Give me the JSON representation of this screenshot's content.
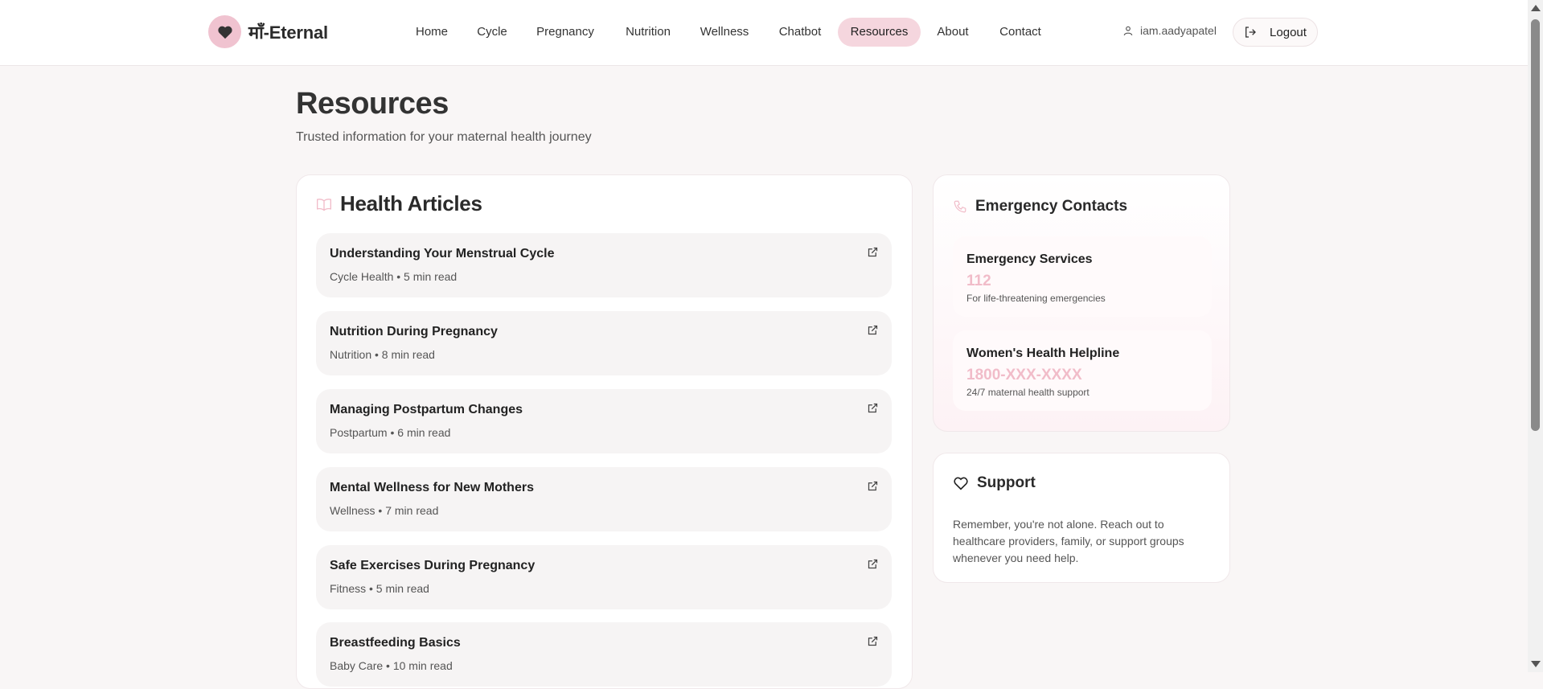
{
  "brand": {
    "name": "माँ-Eternal",
    "icon": "heart-icon",
    "badge_color": "#f0c3d0"
  },
  "nav": {
    "items": [
      {
        "label": "Home",
        "active": false
      },
      {
        "label": "Cycle",
        "active": false
      },
      {
        "label": "Pregnancy",
        "active": false
      },
      {
        "label": "Nutrition",
        "active": false
      },
      {
        "label": "Wellness",
        "active": false
      },
      {
        "label": "Chatbot",
        "active": false
      },
      {
        "label": "Resources",
        "active": true
      },
      {
        "label": "About",
        "active": false
      },
      {
        "label": "Contact",
        "active": false
      }
    ],
    "active_color": "#f5d6de"
  },
  "user": {
    "username": "iam.aadyapatel",
    "logout_label": "Logout"
  },
  "page": {
    "title": "Resources",
    "subtitle": "Trusted information for your maternal health journey"
  },
  "articles": {
    "title": "Health Articles",
    "icon": "book-open-icon",
    "items": [
      {
        "title": "Understanding Your Menstrual Cycle",
        "meta": "Cycle Health • 5 min read"
      },
      {
        "title": "Nutrition During Pregnancy",
        "meta": "Nutrition • 8 min read"
      },
      {
        "title": "Managing Postpartum Changes",
        "meta": "Postpartum • 6 min read"
      },
      {
        "title": "Mental Wellness for New Mothers",
        "meta": "Wellness • 7 min read"
      },
      {
        "title": "Safe Exercises During Pregnancy",
        "meta": "Fitness • 5 min read"
      },
      {
        "title": "Breastfeeding Basics",
        "meta": "Baby Care • 10 min read"
      }
    ]
  },
  "emergency": {
    "title": "Emergency Contacts",
    "icon": "phone-icon",
    "contacts": [
      {
        "name": "Emergency Services",
        "phone": "112",
        "desc": "For life-threatening emergencies"
      },
      {
        "name": "Women's Health Helpline",
        "phone": "1800-XXX-XXXX",
        "desc": "24/7 maternal health support"
      }
    ],
    "phone_color": "#f1bcc9"
  },
  "support": {
    "title": "Support",
    "icon": "heart-outline-icon",
    "text": "Remember, you're not alone. Reach out to healthcare providers, family, or support groups whenever you need help."
  }
}
